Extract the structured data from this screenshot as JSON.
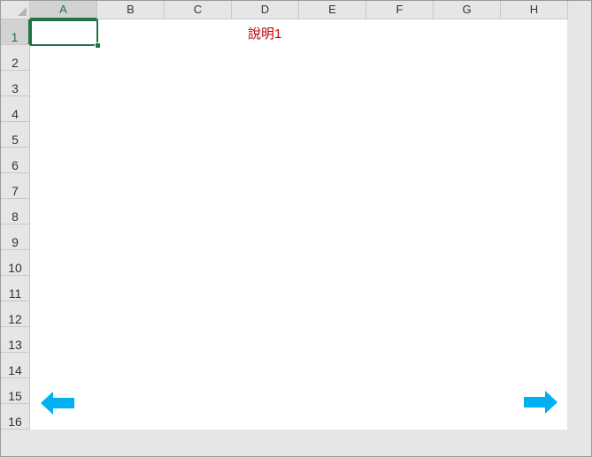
{
  "columns": [
    "A",
    "B",
    "C",
    "D",
    "E",
    "F",
    "G",
    "H"
  ],
  "rows": [
    "1",
    "2",
    "3",
    "4",
    "5",
    "6",
    "7",
    "8",
    "9",
    "10",
    "11",
    "12",
    "13",
    "14",
    "15",
    "16"
  ],
  "selected_column": "A",
  "selected_row": "1",
  "cells": {
    "D1": "說明1"
  },
  "colors": {
    "accent": "#217346",
    "text_red": "#c00000",
    "arrow": "#00b0f0"
  },
  "icons": {
    "prev": "left-arrow-icon",
    "next": "right-arrow-icon"
  }
}
